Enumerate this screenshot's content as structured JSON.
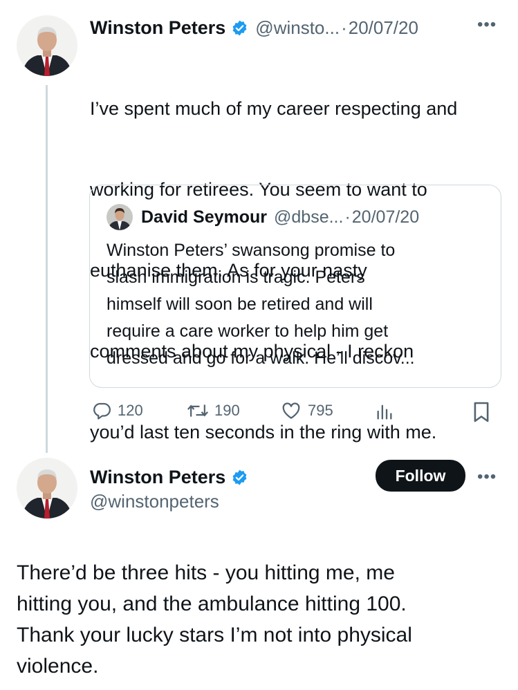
{
  "tweet1": {
    "author": "Winston Peters",
    "handle": "@winsto...",
    "separator": "·",
    "date": "20/07/20",
    "text": "I’ve spent much of my career respecting and working for retirees. You seem to want to euthanise them. As for your nasty comments about my physical - I reckon you’d last ten seconds in the ring with me.",
    "lines": [
      "I’ve spent much of my career respecting and",
      "working for retirees. You seem to want to",
      "euthanise them. As for your nasty",
      "comments about my physical - I reckon",
      "you’d last ten seconds in the ring with me."
    ],
    "replies": "120",
    "retweets": "190",
    "likes": "795"
  },
  "quote": {
    "author": "David Seymour",
    "handle": "@dbse...",
    "separator": "·",
    "date": "20/07/20",
    "lines": [
      "Winston Peters’ swansong promise to",
      "slash immigration is tragic. Peters",
      "himself will soon be retired and will",
      "require a care worker to help him get",
      "dressed and go for a walk. He’ll discov..."
    ]
  },
  "tweet2": {
    "author": "Winston Peters",
    "handle": "@winstonpeters",
    "follow_label": "Follow",
    "lines": [
      "There’d be three hits - you hitting me, me",
      "hitting you, and the ambulance hitting 100.",
      "Thank your lucky stars I’m not into physical",
      "violence."
    ]
  },
  "icons": {
    "verified": "verified-badge-icon",
    "more": "more-dots-icon",
    "reply": "reply-icon",
    "retweet": "retweet-icon",
    "like": "heart-icon",
    "views": "views-icon",
    "bookmark": "bookmark-icon"
  },
  "colors": {
    "verified": "#1d9bf0",
    "muted": "#536471",
    "thread_line": "#cfd9de",
    "follow_bg": "#0f1419"
  }
}
